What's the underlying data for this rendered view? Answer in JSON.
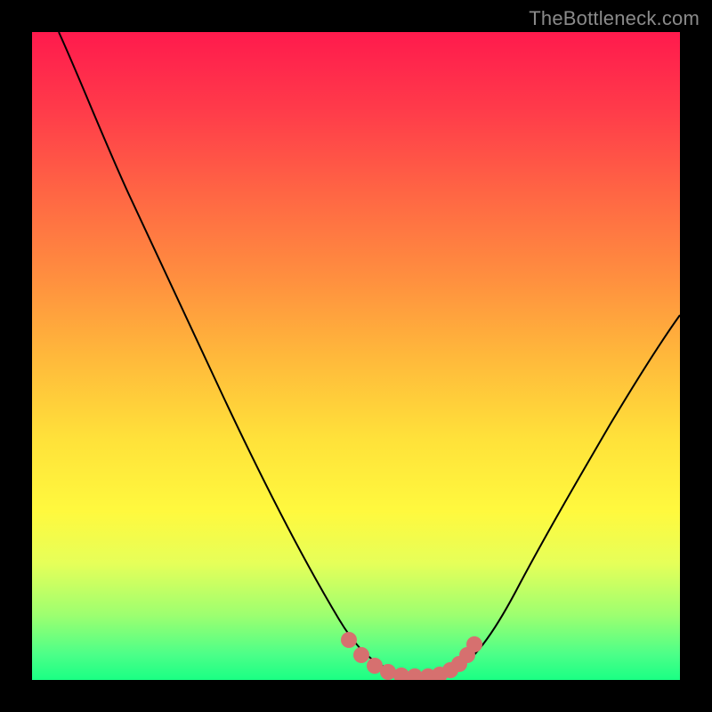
{
  "watermark": "TheBottleneck.com",
  "colors": {
    "curve_stroke": "#000000",
    "marker_fill": "#d6706f",
    "marker_stroke": "#d6706f",
    "frame": "#000000"
  },
  "chart_data": {
    "type": "line",
    "title": "",
    "xlabel": "",
    "ylabel": "",
    "xlim": [
      0,
      100
    ],
    "ylim": [
      0,
      100
    ],
    "curve": {
      "name": "bottleneck-curve",
      "x": [
        0,
        5,
        10,
        15,
        20,
        25,
        30,
        35,
        40,
        45,
        50,
        52,
        54,
        56,
        58,
        60,
        62,
        65,
        70,
        75,
        80,
        85,
        90,
        95,
        100
      ],
      "y": [
        100,
        94,
        87,
        80,
        72,
        64,
        55,
        46,
        36,
        25,
        12,
        7,
        3,
        1,
        0,
        0,
        1,
        4,
        11,
        21,
        32,
        42,
        52,
        60,
        67
      ]
    },
    "markers": {
      "name": "optimal-range",
      "points": [
        {
          "x": 50,
          "y": 6
        },
        {
          "x": 52,
          "y": 3
        },
        {
          "x": 54,
          "y": 1.5
        },
        {
          "x": 56,
          "y": 0.8
        },
        {
          "x": 58,
          "y": 0.5
        },
        {
          "x": 60,
          "y": 0.7
        },
        {
          "x": 62,
          "y": 1.2
        },
        {
          "x": 64,
          "y": 2.2
        },
        {
          "x": 65,
          "y": 3
        }
      ]
    },
    "legend": null,
    "grid": false
  }
}
